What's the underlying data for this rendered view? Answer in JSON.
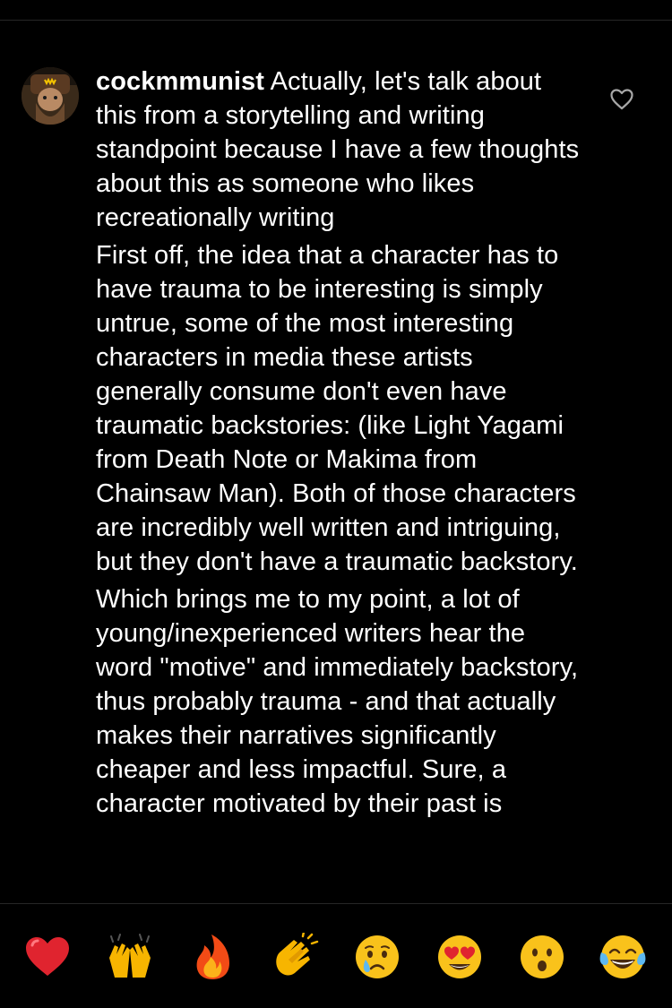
{
  "comment": {
    "username": "cockmmunist",
    "intro": "Actually, let's talk about this from a storytelling and writing standpoint because I have a few thoughts about this as someone who likes recreationally writing",
    "paragraph_2": "First off, the idea that a character has to have trauma to be interesting is simply untrue, some of the most interesting characters in media these artists generally consume don't even have traumatic backstories: (like Light Yagami from Death Note or Makima from Chainsaw Man). Both of those characters are incredibly well written and intriguing, but they don't have a traumatic backstory.",
    "paragraph_3": "Which brings me to my point, a lot of young/inexperienced writers hear the word \"motive\" and immediately backstory, thus probably trauma - and that actually makes their narratives significantly cheaper and less impactful. Sure, a character motivated by their past is",
    "like_icon": "heart-outline-icon",
    "avatar": "user-avatar"
  },
  "reactions": [
    {
      "name": "red-heart-emoji"
    },
    {
      "name": "raising-hands-emoji"
    },
    {
      "name": "fire-emoji"
    },
    {
      "name": "clapping-hands-emoji"
    },
    {
      "name": "crying-face-emoji"
    },
    {
      "name": "heart-eyes-emoji"
    },
    {
      "name": "surprised-face-emoji"
    },
    {
      "name": "tears-of-joy-emoji"
    }
  ],
  "colors": {
    "background": "#000000",
    "text": "#ffffff",
    "divider": "#262626",
    "icon": "#a8a8a8"
  }
}
